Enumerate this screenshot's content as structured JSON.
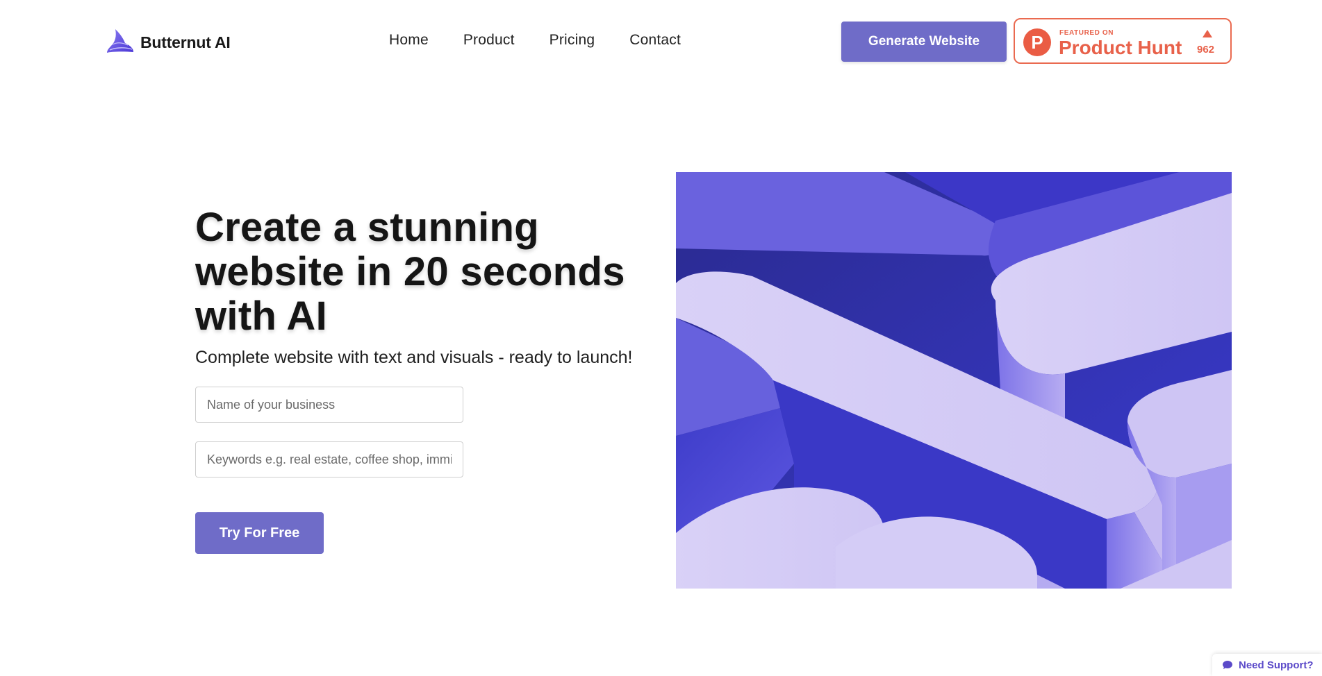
{
  "brand": {
    "name": "Butternut AI",
    "logo_icon": "butternut-logo-icon",
    "accent_color": "#6f6cc8"
  },
  "nav": {
    "items": [
      {
        "label": "Home"
      },
      {
        "label": "Product"
      },
      {
        "label": "Pricing"
      },
      {
        "label": "Contact"
      }
    ]
  },
  "header": {
    "cta_label": "Generate Website"
  },
  "product_hunt": {
    "featured_label": "FEATURED ON",
    "name": "Product Hunt",
    "logo_letter": "P",
    "upvote_icon": "upvote-arrow-icon",
    "upvotes": "962",
    "color": "#e8614a"
  },
  "hero": {
    "title": "Create a stunning website in 20 seconds with AI",
    "subtitle": "Complete website with text and visuals - ready to launch!",
    "business_placeholder": "Name of your business",
    "keywords_placeholder": "Keywords e.g. real estate, coffee shop, immigration lawyer",
    "cta_label": "Try For Free",
    "image_icon": "abstract-3d-shapes-image"
  },
  "support": {
    "label": "Need Support?",
    "icon": "chat-bubble-icon"
  }
}
